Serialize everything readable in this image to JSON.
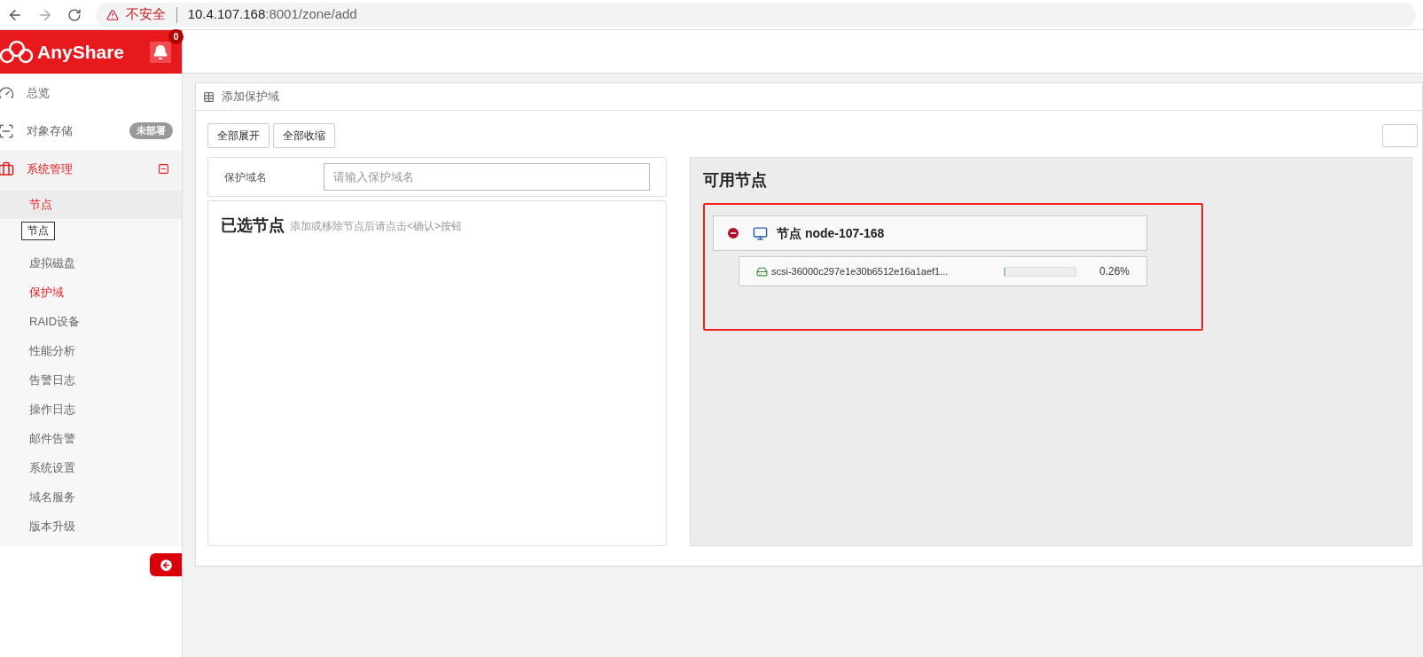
{
  "browser": {
    "security_label": "不安全",
    "url_host": "10.4.107.168",
    "url_rest": ":8001/zone/add"
  },
  "header": {
    "brand": "AnyShare",
    "notification_count": "0"
  },
  "sidebar": {
    "items": [
      {
        "label": "总览",
        "selected": false
      },
      {
        "label": "对象存储",
        "badge": "未部署",
        "selected": false
      },
      {
        "label": "系统管理",
        "expanded": true,
        "selected": true,
        "children": [
          {
            "label": "节点",
            "selected": false,
            "hovered": true
          },
          {
            "label": "虚拟磁盘",
            "selected": false,
            "hovered": false
          },
          {
            "label": "保护域",
            "selected": true,
            "hovered": false
          },
          {
            "label": "RAID设备",
            "selected": false,
            "hovered": false
          },
          {
            "label": "性能分析",
            "selected": false,
            "hovered": false
          },
          {
            "label": "告警日志",
            "selected": false,
            "hovered": false
          },
          {
            "label": "操作日志",
            "selected": false,
            "hovered": false
          },
          {
            "label": "邮件告警",
            "selected": false,
            "hovered": false
          },
          {
            "label": "系统设置",
            "selected": false,
            "hovered": false
          },
          {
            "label": "域名服务",
            "selected": false,
            "hovered": false
          },
          {
            "label": "版本升级",
            "selected": false,
            "hovered": false
          }
        ]
      }
    ]
  },
  "tooltip": "节点",
  "panel": {
    "title": "添加保护域",
    "buttons": [
      "全部展开",
      "全部收缩"
    ],
    "name_field": {
      "label": "保护域名",
      "placeholder": "请输入保护域名"
    },
    "selected_nodes": {
      "title": "已选节点",
      "hint": "添加或移除节点后请点击<确认>按钮"
    },
    "available_nodes": {
      "title": "可用节点",
      "nodes": [
        {
          "name": "节点 node-107-168",
          "disks": [
            {
              "name": "scsi-36000c297e1e30b6512e16a1aef1...",
              "level": 0.0026,
              "reading": "0.26%"
            }
          ]
        }
      ]
    }
  }
}
